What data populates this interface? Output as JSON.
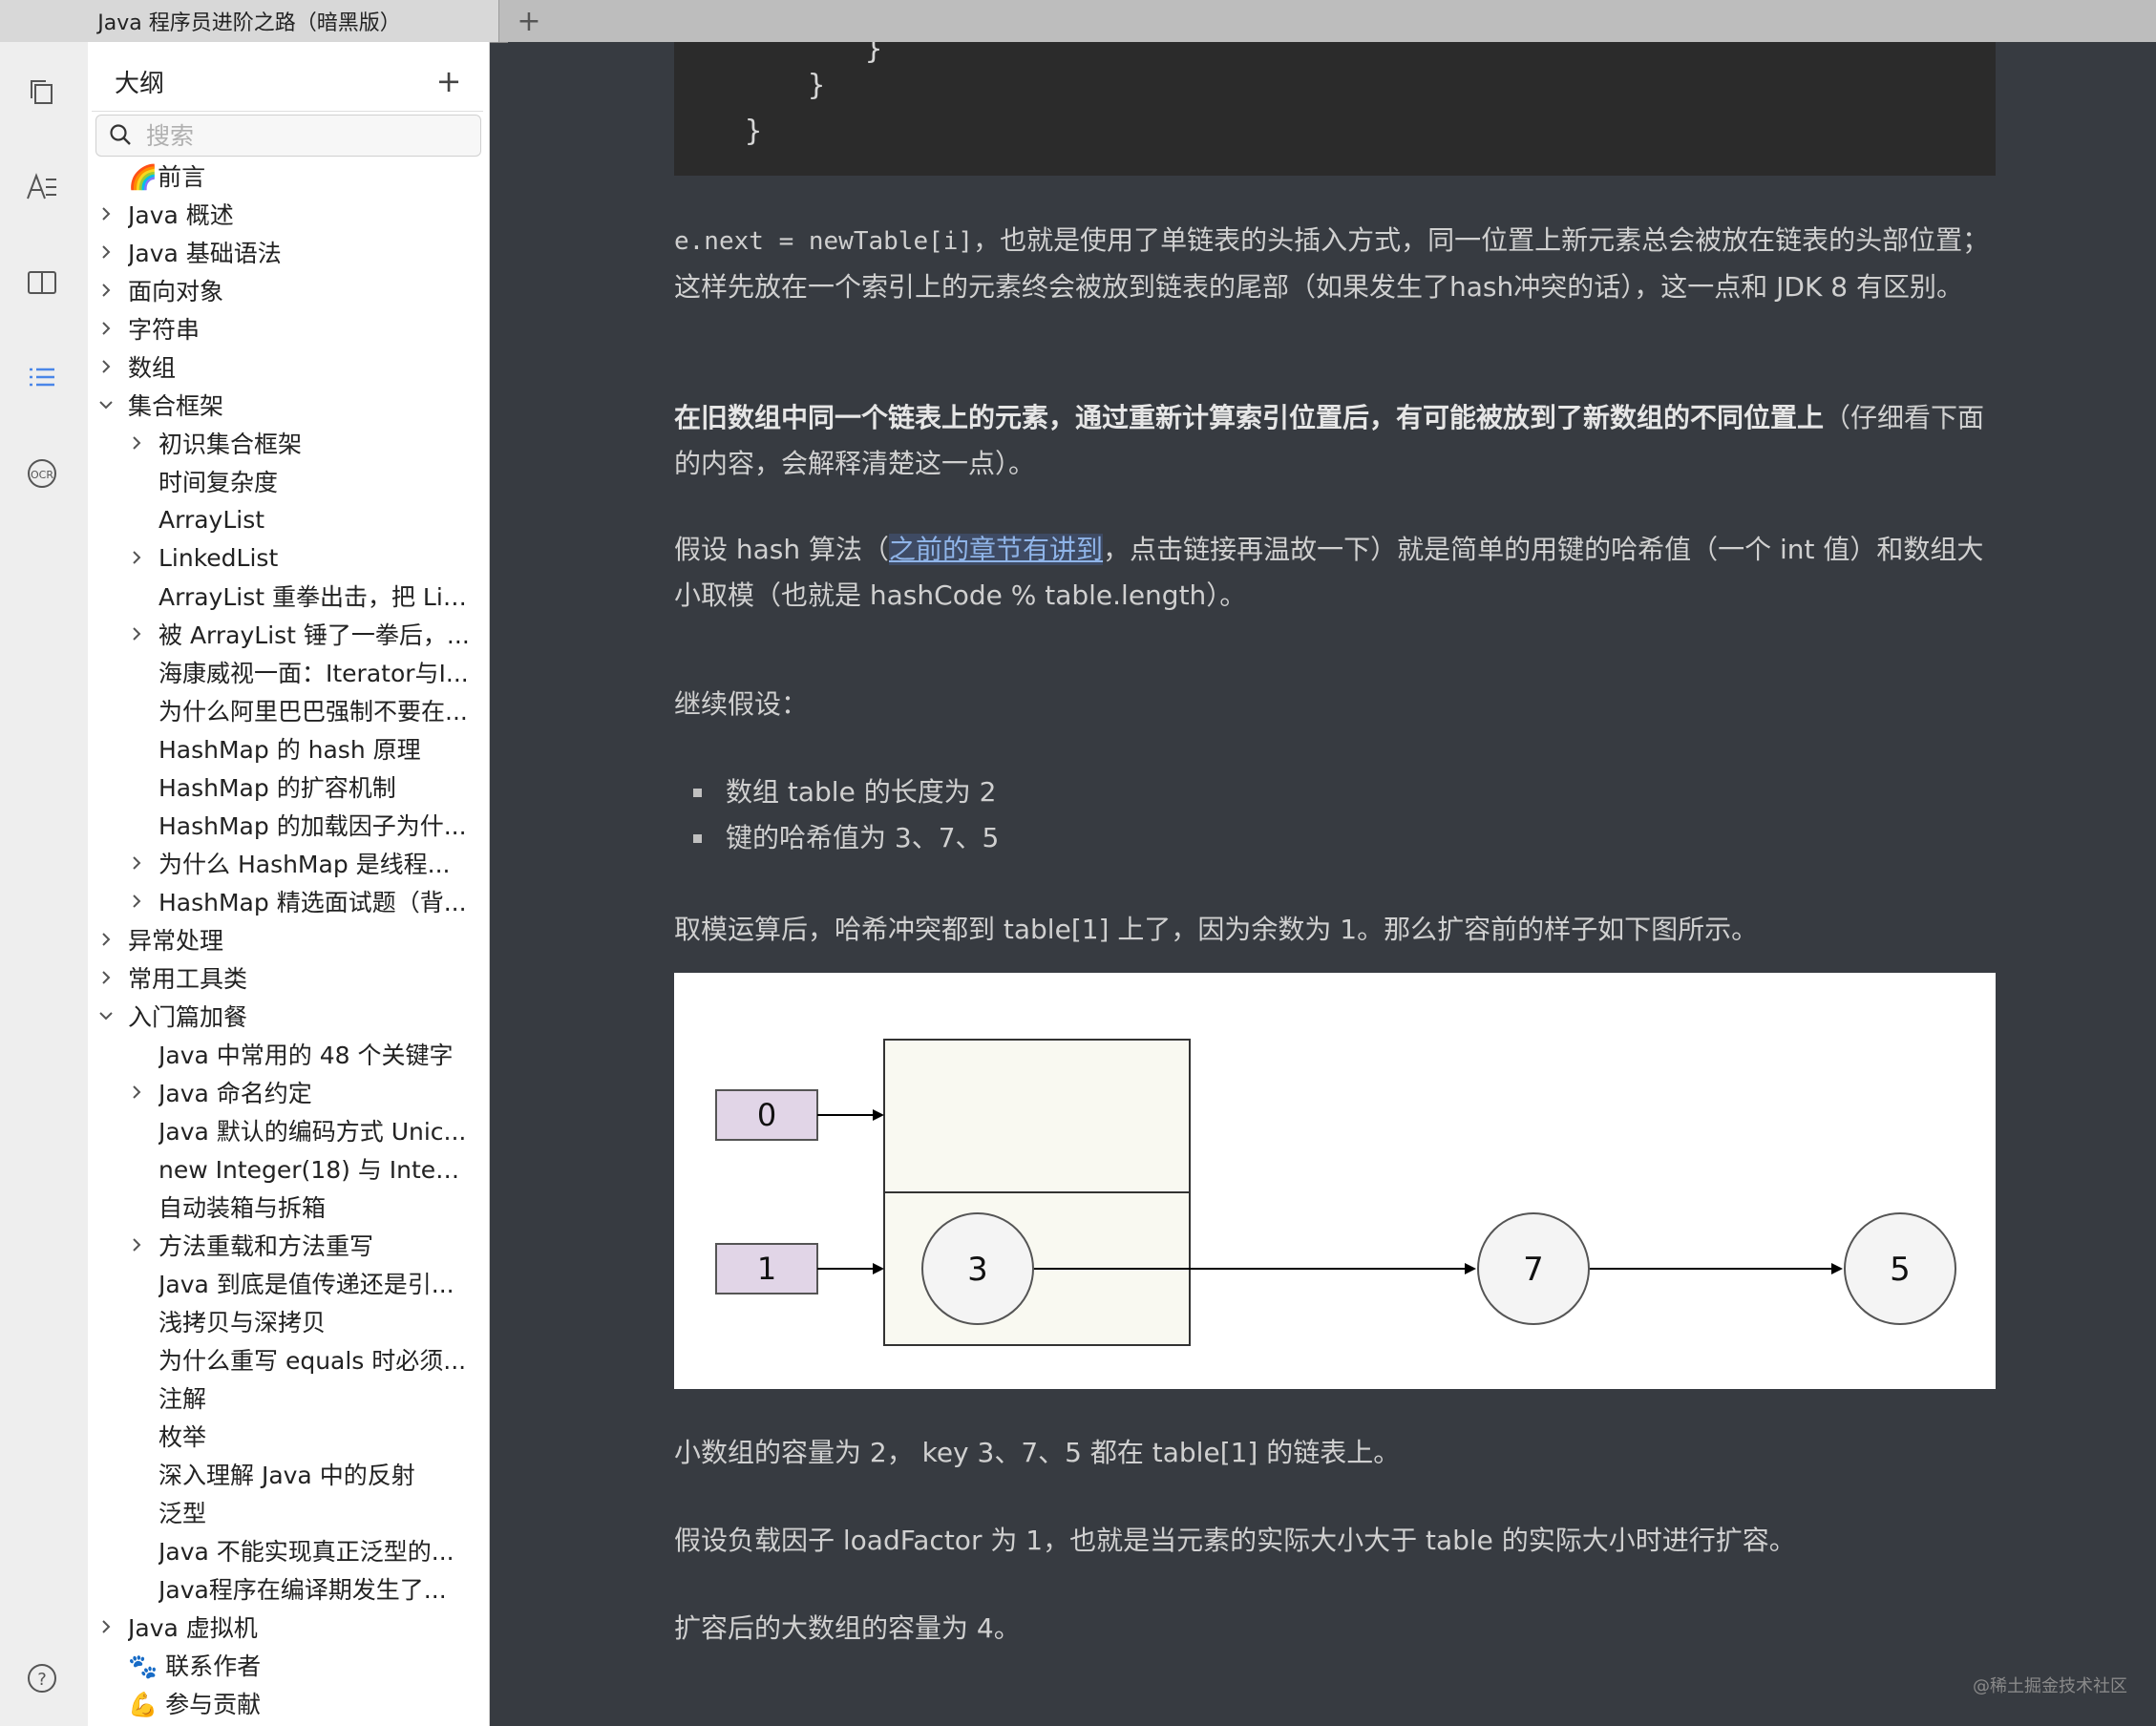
{
  "window": {
    "tab_title": "Java 程序员进阶之路（暗黑版）",
    "tab_add": "+"
  },
  "activity_bar": {
    "icons": [
      "files-icon",
      "font-icon",
      "book-icon",
      "outline-list-icon",
      "ocr-icon",
      "help-icon"
    ],
    "accent": "#4a86e8",
    "ocr_label": "OCR",
    "help_label": "?"
  },
  "outline": {
    "title": "大纲",
    "add": "+",
    "search_placeholder": "搜索",
    "items": [
      {
        "label": "🌈前言",
        "level": 1,
        "expand": "none"
      },
      {
        "label": "Java 概述",
        "level": 1,
        "expand": "collapsed"
      },
      {
        "label": "Java 基础语法",
        "level": 1,
        "expand": "collapsed"
      },
      {
        "label": "面向对象",
        "level": 1,
        "expand": "collapsed"
      },
      {
        "label": "字符串",
        "level": 1,
        "expand": "collapsed"
      },
      {
        "label": "数组",
        "level": 1,
        "expand": "collapsed"
      },
      {
        "label": "集合框架",
        "level": 1,
        "expand": "expanded"
      },
      {
        "label": "初识集合框架",
        "level": 2,
        "expand": "collapsed"
      },
      {
        "label": "时间复杂度",
        "level": 2,
        "expand": "none"
      },
      {
        "label": "ArrayList",
        "level": 2,
        "expand": "none"
      },
      {
        "label": "LinkedList",
        "level": 2,
        "expand": "collapsed"
      },
      {
        "label": "ArrayList 重拳出击，把 Lin...",
        "level": 2,
        "expand": "none"
      },
      {
        "label": "被 ArrayList 锤了一拳后，...",
        "level": 2,
        "expand": "collapsed"
      },
      {
        "label": "海康威视一面：Iterator与I...",
        "level": 2,
        "expand": "none"
      },
      {
        "label": "为什么阿里巴巴强制不要在...",
        "level": 2,
        "expand": "none"
      },
      {
        "label": "HashMap 的 hash 原理",
        "level": 2,
        "expand": "none"
      },
      {
        "label": "HashMap 的扩容机制",
        "level": 2,
        "expand": "none"
      },
      {
        "label": "HashMap 的加载因子为什...",
        "level": 2,
        "expand": "none"
      },
      {
        "label": "为什么 HashMap 是线程...",
        "level": 2,
        "expand": "collapsed"
      },
      {
        "label": "HashMap 精选面试题（背...",
        "level": 2,
        "expand": "collapsed"
      },
      {
        "label": "异常处理",
        "level": 1,
        "expand": "collapsed"
      },
      {
        "label": "常用工具类",
        "level": 1,
        "expand": "collapsed"
      },
      {
        "label": "入门篇加餐",
        "level": 1,
        "expand": "expanded"
      },
      {
        "label": "Java 中常用的 48 个关键字",
        "level": 2,
        "expand": "none"
      },
      {
        "label": "Java 命名约定",
        "level": 2,
        "expand": "collapsed"
      },
      {
        "label": "Java 默认的编码方式 Unic...",
        "level": 2,
        "expand": "none"
      },
      {
        "label": "new Integer(18) 与 Integer...",
        "level": 2,
        "expand": "none"
      },
      {
        "label": "自动装箱与拆箱",
        "level": 2,
        "expand": "none"
      },
      {
        "label": "方法重载和方法重写",
        "level": 2,
        "expand": "collapsed"
      },
      {
        "label": "Java 到底是值传递还是引...",
        "level": 2,
        "expand": "none"
      },
      {
        "label": "浅拷贝与深拷贝",
        "level": 2,
        "expand": "none"
      },
      {
        "label": "为什么重写 equals 时必须...",
        "level": 2,
        "expand": "none"
      },
      {
        "label": "注解",
        "level": 2,
        "expand": "none"
      },
      {
        "label": "枚举",
        "level": 2,
        "expand": "none"
      },
      {
        "label": "深入理解 Java 中的反射",
        "level": 2,
        "expand": "none"
      },
      {
        "label": "泛型",
        "level": 2,
        "expand": "none"
      },
      {
        "label": "Java 不能实现真正泛型的...",
        "level": 2,
        "expand": "none"
      },
      {
        "label": "Java程序在编译期发生了...",
        "level": 2,
        "expand": "none"
      },
      {
        "label": "Java 虚拟机",
        "level": 1,
        "expand": "collapsed"
      },
      {
        "label": "🐾 联系作者",
        "level": 1,
        "expand": "none"
      },
      {
        "label": "💪 参与贡献",
        "level": 1,
        "expand": "none"
      }
    ]
  },
  "content": {
    "code_lines": [
      "}",
      "}",
      "}"
    ],
    "p1": {
      "code": "e.next = newTable[i]",
      "text": "，也就是使用了单链表的头插入方式，同一位置上新元素总会被放在链表的头部位置；这样先放在一个索引上的元素终会被放到链表的尾部（如果发生了hash冲突的话），这一点和 JDK 8 有区别。"
    },
    "p2": {
      "bold": "在旧数组中同一个链表上的元素，通过重新计算索引位置后，有可能被放到了新数组的不同位置上",
      "rest": "（仔细看下面的内容，会解释清楚这一点）。"
    },
    "p3": {
      "before": "假设 hash 算法（",
      "link": "之前的章节有讲到",
      "after": "，点击链接再温故一下）就是简单的用键的哈希值（一个 int 值）和数组大小取模（也就是 hashCode % table.length）。"
    },
    "p4": "继续假设：",
    "bullets": [
      "数组 table 的长度为 2",
      "键的哈希值为 3、7、5"
    ],
    "p5": "取模运算后，哈希冲突都到 table[1] 上了，因为余数为 1。那么扩容前的样子如下图所示。",
    "figure": {
      "indices": [
        "0",
        "1"
      ],
      "nodes": [
        "3",
        "7",
        "5"
      ],
      "index_fill": "#e1d5e7",
      "bucket_fill": "#f9f9f1"
    },
    "p6": "小数组的容量为 2， key 3、7、5 都在 table[1] 的链表上。",
    "p7": "假设负载因子 loadFactor 为 1，也就是当元素的实际大小大于 table 的实际大小时进行扩容。",
    "p8": "扩容后的大数组的容量为 4。",
    "watermark": "@稀土掘金技术社区"
  }
}
